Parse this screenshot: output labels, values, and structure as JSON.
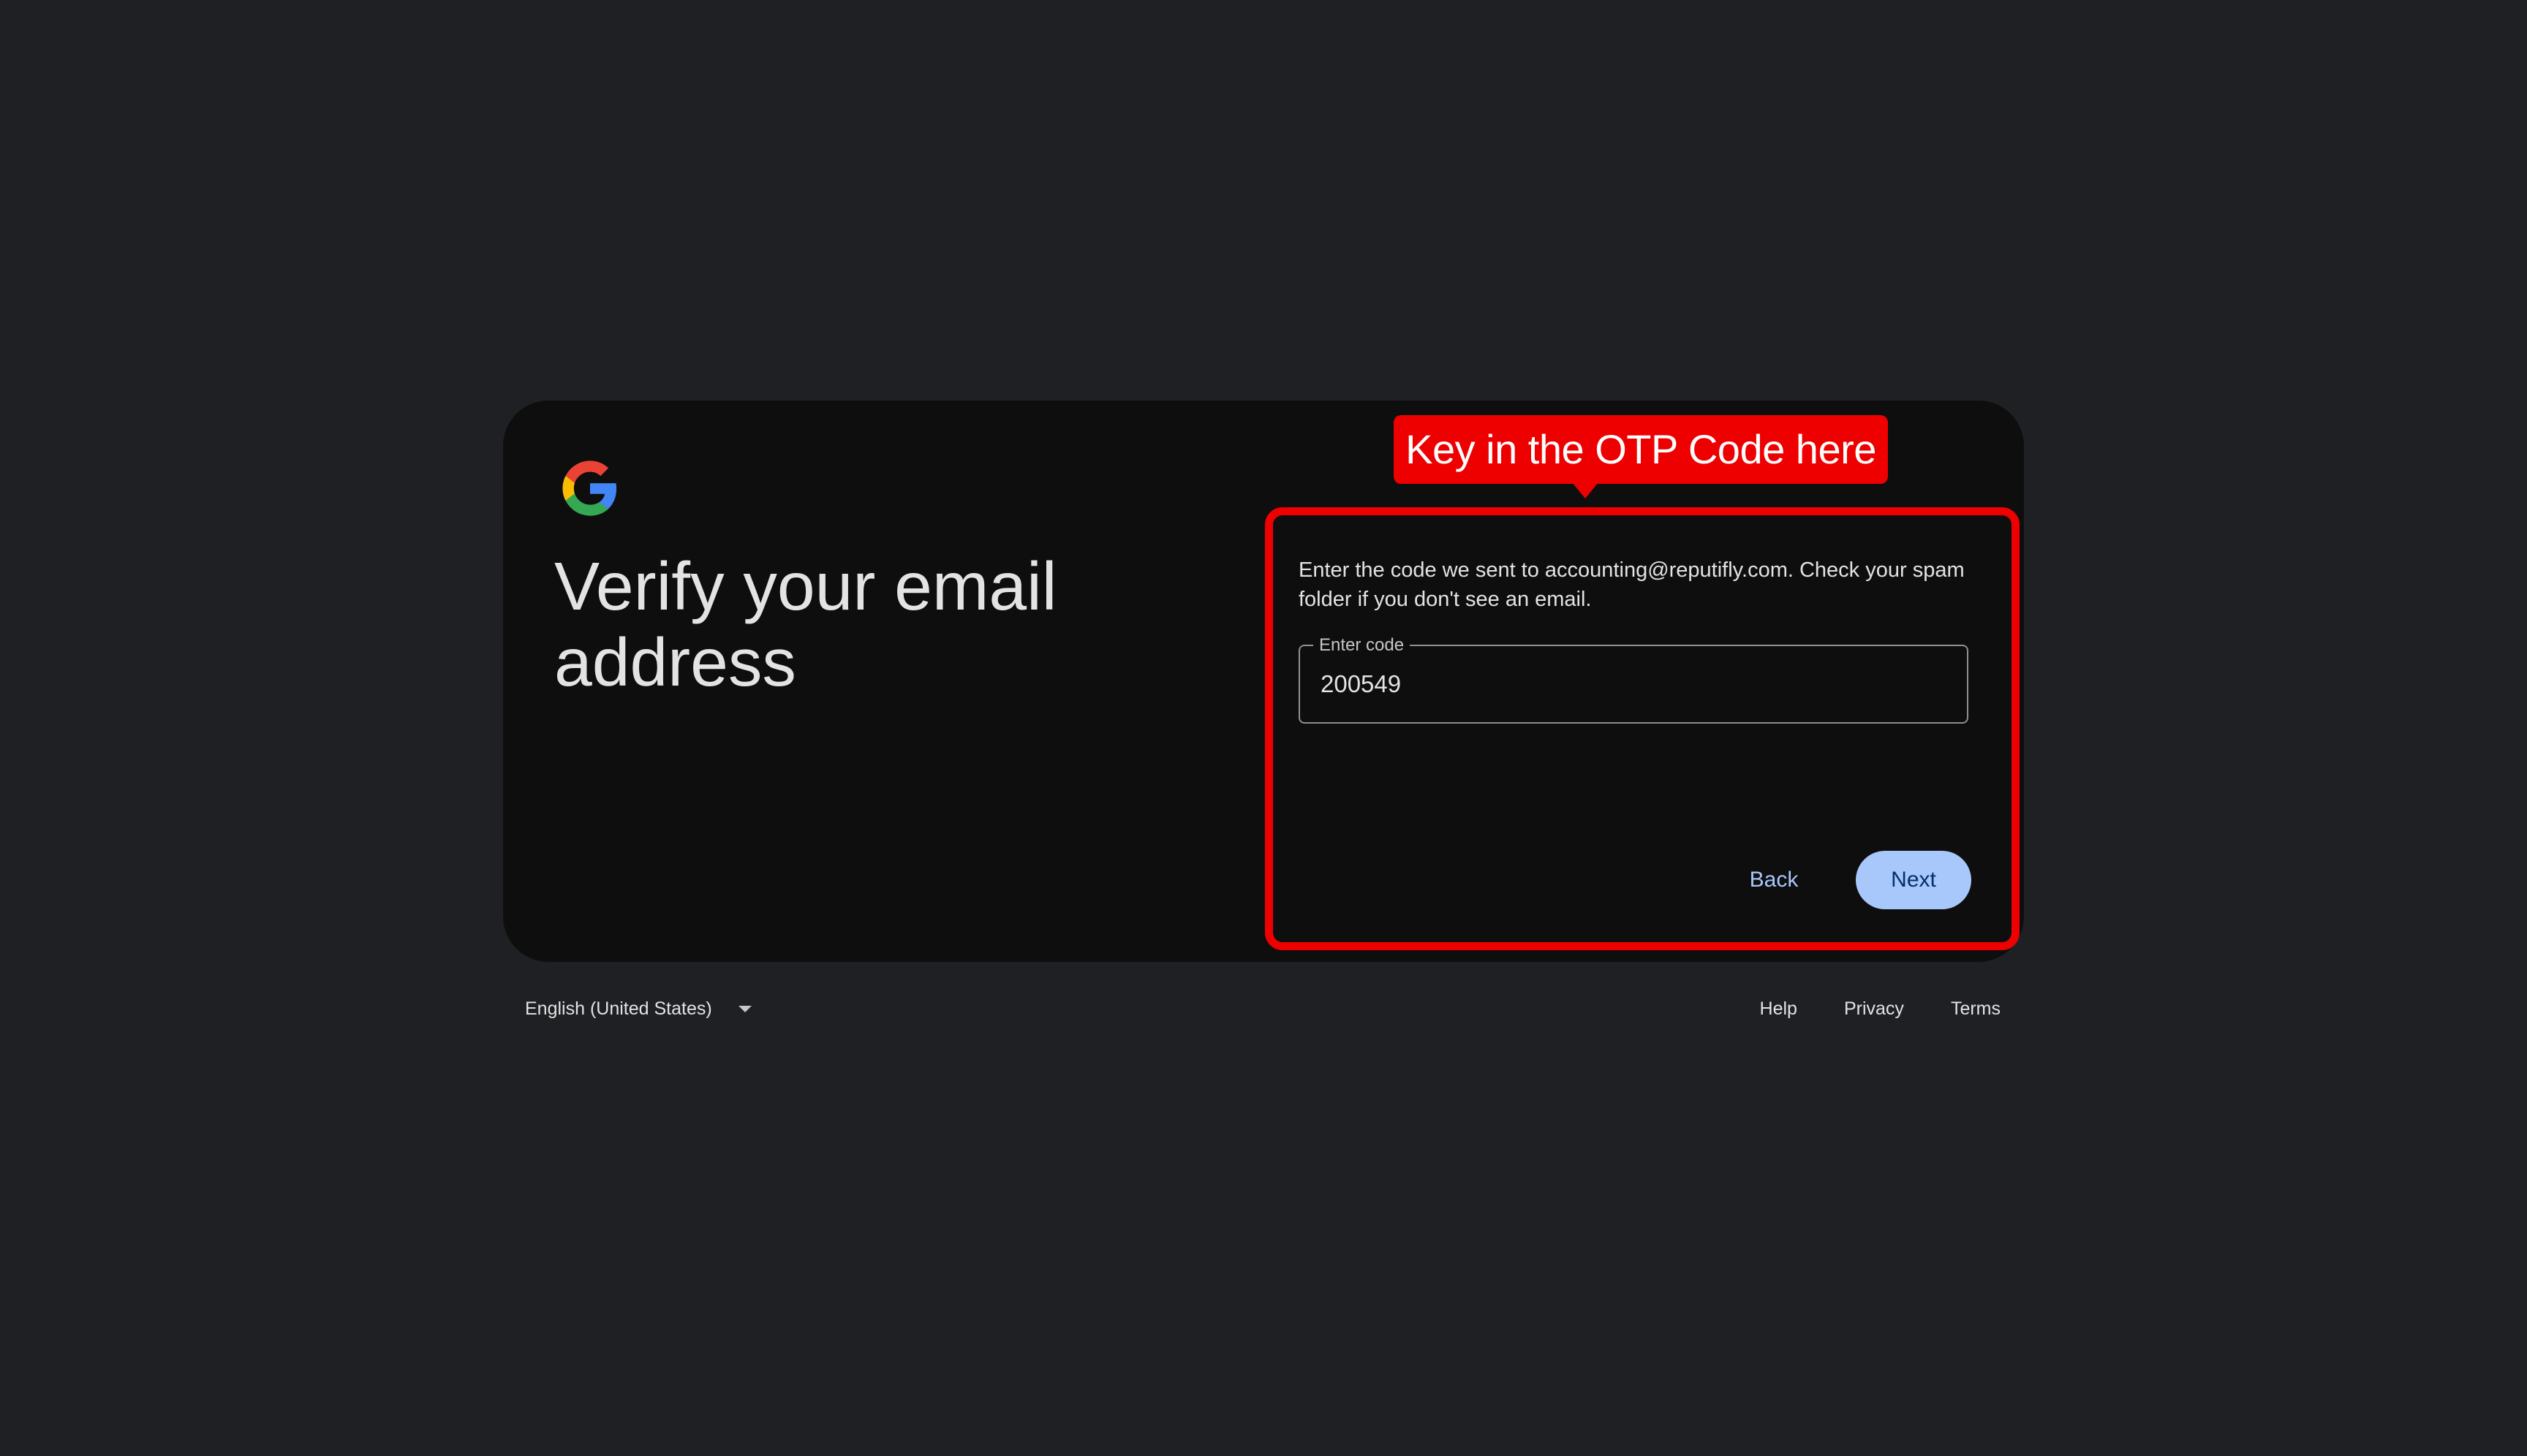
{
  "colors": {
    "background": "#1f2023",
    "card": "#0e0e0f",
    "primary_button": "#a8c7fa",
    "annotation_red": "#ee0000"
  },
  "header": {
    "logo_icon": "google-g-logo",
    "title": "Verify your email address"
  },
  "form": {
    "instructions": "Enter the code we sent to accounting@reputifly.com. Check your spam folder if you don't see an email.",
    "code_label": "Enter code",
    "code_value": "200549",
    "back_label": "Back",
    "next_label": "Next"
  },
  "annotation": {
    "callout_text": "Key in the OTP Code here"
  },
  "footer": {
    "language": "English (United States)",
    "links": {
      "help": "Help",
      "privacy": "Privacy",
      "terms": "Terms"
    }
  }
}
